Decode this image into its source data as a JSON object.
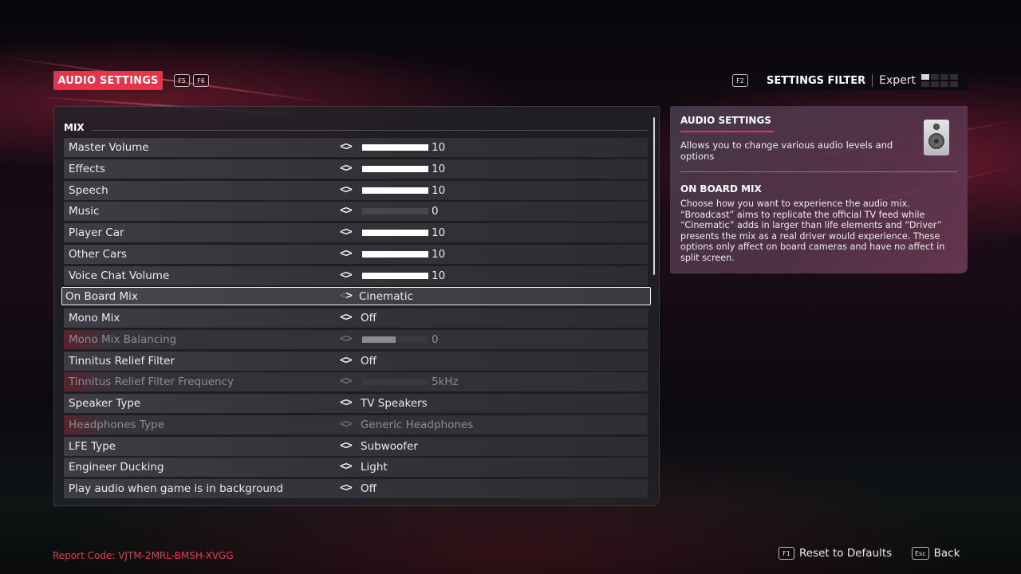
{
  "header": {
    "active_tab": "AUDIO SETTINGS",
    "key_prev": "F5",
    "key_next": "F6",
    "filter_key": "F2",
    "filter_label": "SETTINGS FILTER",
    "filter_value": "Expert"
  },
  "section": {
    "title": "MIX"
  },
  "settings": [
    {
      "name": "Master Volume",
      "type": "slider",
      "value": "10",
      "fill": 1.0,
      "state": "normal"
    },
    {
      "name": "Effects",
      "type": "slider",
      "value": "10",
      "fill": 1.0,
      "state": "normal"
    },
    {
      "name": "Speech",
      "type": "slider",
      "value": "10",
      "fill": 1.0,
      "state": "normal"
    },
    {
      "name": "Music",
      "type": "slider",
      "value": "0",
      "fill": 0.0,
      "state": "normal"
    },
    {
      "name": "Player Car",
      "type": "slider",
      "value": "10",
      "fill": 1.0,
      "state": "normal"
    },
    {
      "name": "Other Cars",
      "type": "slider",
      "value": "10",
      "fill": 1.0,
      "state": "normal"
    },
    {
      "name": "Voice Chat Volume",
      "type": "slider",
      "value": "10",
      "fill": 1.0,
      "state": "normal"
    },
    {
      "name": "On Board Mix",
      "type": "option",
      "value": "Cinematic",
      "state": "selected"
    },
    {
      "name": "Mono Mix",
      "type": "option",
      "value": "Off",
      "state": "normal"
    },
    {
      "name": "Mono Mix Balancing",
      "type": "slider",
      "value": "0",
      "fill": 0.5,
      "state": "disabled"
    },
    {
      "name": "Tinnitus Relief Filter",
      "type": "option",
      "value": "Off",
      "state": "normal"
    },
    {
      "name": "Tinnitus Relief Filter Frequency",
      "type": "slider",
      "value": "5kHz",
      "fill": 0.0,
      "state": "disabled"
    },
    {
      "name": "Speaker Type",
      "type": "option",
      "value": "TV Speakers",
      "state": "normal"
    },
    {
      "name": "Headphones Type",
      "type": "option",
      "value": "Generic Headphones",
      "state": "disabled"
    },
    {
      "name": "LFE Type",
      "type": "option",
      "value": "Subwoofer",
      "state": "normal"
    },
    {
      "name": "Engineer Ducking",
      "type": "option",
      "value": "Light",
      "state": "normal"
    },
    {
      "name": "Play audio when game is in background",
      "type": "option",
      "value": "Off",
      "state": "normal"
    }
  ],
  "info": {
    "title": "AUDIO SETTINGS",
    "description": "Allows you to change various audio levels and options",
    "item_title": "ON BOARD MIX",
    "item_description": "Choose how you want to experience the audio mix. “Broadcast” aims to replicate the official TV feed while “Cinematic” adds in larger than life elements and “Driver” presents the mix as a real driver would experience. These options only affect on board cameras and have no affect in split screen."
  },
  "footer": {
    "report_code": "Report Code: VJTM-2MRL-BMSH-XVGG",
    "reset_key": "F1",
    "reset_label": "Reset to Defaults",
    "back_key": "Esc",
    "back_label": "Back"
  },
  "colors": {
    "accent": "#e8334d",
    "panel": "#222228",
    "text": "#ececee"
  }
}
